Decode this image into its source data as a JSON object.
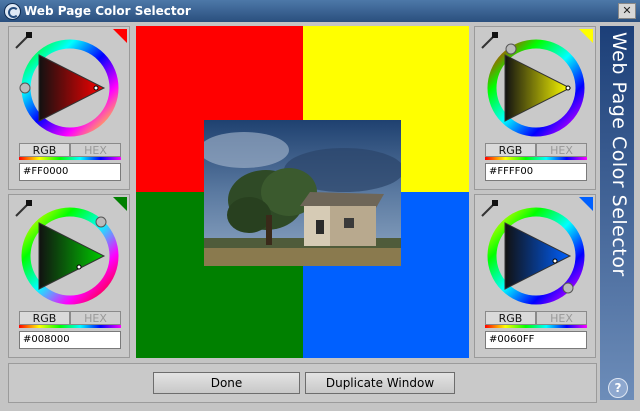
{
  "window": {
    "title": "Web Page Color Selector",
    "close_glyph": "✕"
  },
  "sidebar": {
    "title": "Web Page Color Selector",
    "help_glyph": "?"
  },
  "panels": [
    {
      "color": "#FF0000",
      "tab_rgb": "RGB",
      "tab_hex": "HEX",
      "hex_value": "#FF0000"
    },
    {
      "color": "#FFFF00",
      "tab_rgb": "RGB",
      "tab_hex": "HEX",
      "hex_value": "#FFFF00"
    },
    {
      "color": "#008000",
      "tab_rgb": "RGB",
      "tab_hex": "HEX",
      "hex_value": "#008000"
    },
    {
      "color": "#0060FF",
      "tab_rgb": "RGB",
      "tab_hex": "HEX",
      "hex_value": "#0060FF"
    }
  ],
  "buttons": {
    "done": "Done",
    "duplicate": "Duplicate Window"
  },
  "icons": [
    "app-icon",
    "close-icon",
    "eyedropper-icon",
    "help-icon"
  ]
}
